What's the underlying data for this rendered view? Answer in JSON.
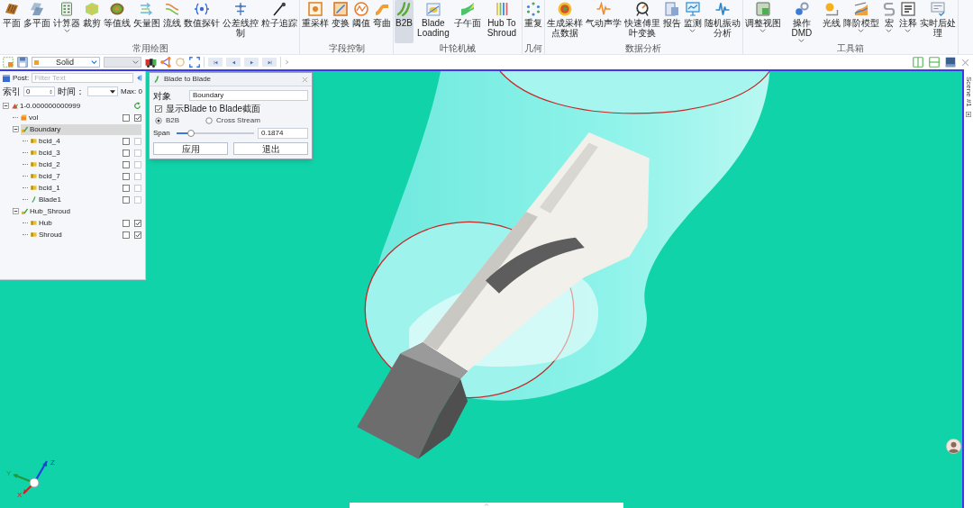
{
  "ribbon": {
    "groups": [
      {
        "title": "常用绘图",
        "buttons": [
          {
            "label": "平面",
            "dropdown": false,
            "selected": false
          },
          {
            "label": "多平面",
            "dropdown": false,
            "selected": false
          },
          {
            "label": "计算器",
            "dropdown": true,
            "selected": false
          },
          {
            "label": "裁剪",
            "dropdown": false,
            "selected": false
          },
          {
            "label": "等值线",
            "dropdown": false,
            "selected": false
          },
          {
            "label": "矢量图",
            "dropdown": false,
            "selected": false
          },
          {
            "label": "流线",
            "dropdown": false,
            "selected": false
          },
          {
            "label": "数值探针",
            "dropdown": false,
            "selected": false
          },
          {
            "label": "公差线控制",
            "dropdown": false,
            "selected": false
          },
          {
            "label": "粒子追踪",
            "dropdown": false,
            "selected": false
          }
        ]
      },
      {
        "title": "字段控制",
        "buttons": [
          {
            "label": "重采样",
            "dropdown": false,
            "selected": false
          },
          {
            "label": "变换",
            "dropdown": false,
            "selected": false
          },
          {
            "label": "阈值",
            "dropdown": false,
            "selected": false
          },
          {
            "label": "弯曲",
            "dropdown": false,
            "selected": false
          }
        ]
      },
      {
        "title": "叶轮机械",
        "buttons": [
          {
            "label": "B2B",
            "dropdown": false,
            "selected": true
          },
          {
            "label": "Blade Loading",
            "dropdown": false,
            "selected": false
          },
          {
            "label": "子午面",
            "dropdown": false,
            "selected": false
          },
          {
            "label": "Hub To Shroud",
            "dropdown": false,
            "selected": false
          }
        ]
      },
      {
        "title": "几何",
        "buttons": [
          {
            "label": "重复",
            "dropdown": false,
            "selected": false
          }
        ]
      },
      {
        "title": "数据分析",
        "buttons": [
          {
            "label": "生成采样点数据",
            "dropdown": false,
            "selected": false
          },
          {
            "label": "气动声学",
            "dropdown": false,
            "selected": false
          },
          {
            "label": "快速傅里叶变换",
            "dropdown": false,
            "selected": false
          },
          {
            "label": "报告",
            "dropdown": false,
            "selected": false
          },
          {
            "label": "监测",
            "dropdown": true,
            "selected": false
          },
          {
            "label": "随机振动分析",
            "dropdown": false,
            "selected": false
          }
        ]
      },
      {
        "title": "工具箱",
        "buttons": [
          {
            "label": "调整视图",
            "dropdown": true,
            "selected": false
          },
          {
            "label": "操作DMD",
            "dropdown": true,
            "selected": false
          },
          {
            "label": "光线",
            "dropdown": false,
            "selected": false
          },
          {
            "label": "降阶模型",
            "dropdown": true,
            "selected": false
          },
          {
            "label": "宏",
            "dropdown": true,
            "selected": false
          },
          {
            "label": "注释",
            "dropdown": true,
            "selected": false
          },
          {
            "label": "实时后处理",
            "dropdown": false,
            "selected": false
          }
        ]
      }
    ]
  },
  "view_toolbar": {
    "style_dropdown": "Solid"
  },
  "tree_panel": {
    "title": "Post:",
    "filter": {
      "placeholder": "Filter Text"
    },
    "index": {
      "label": "索引",
      "value": "0"
    },
    "time": {
      "label": "时间："
    },
    "max": "Max: 0",
    "nodes": [
      {
        "label": "1-0.000000000999",
        "kind": "root",
        "expanded": true,
        "selected": false,
        "children": [
          {
            "label": "vol",
            "kind": "volume",
            "selected": false,
            "checkbox_1": false,
            "checkbox_2": true
          },
          {
            "label": "Boundary",
            "kind": "group",
            "expanded": true,
            "selected": true,
            "children": [
              {
                "label": "bcid_4",
                "kind": "boundary",
                "selected": false,
                "checkbox_1": false,
                "checkbox_2": false
              },
              {
                "label": "bcid_3",
                "kind": "boundary",
                "selected": false,
                "checkbox_1": false,
                "checkbox_2": false
              },
              {
                "label": "bcid_2",
                "kind": "boundary",
                "selected": false,
                "checkbox_1": false,
                "checkbox_2": false
              },
              {
                "label": "bcid_7",
                "kind": "boundary",
                "selected": false,
                "checkbox_1": false,
                "checkbox_2": false
              },
              {
                "label": "bcid_1",
                "kind": "boundary",
                "selected": false,
                "checkbox_1": false,
                "checkbox_2": false
              },
              {
                "label": "Blade1",
                "kind": "blade",
                "selected": false,
                "checkbox_1": false,
                "checkbox_2": false
              }
            ]
          },
          {
            "label": "Hub_Shroud",
            "kind": "group",
            "expanded": true,
            "selected": false,
            "children": [
              {
                "label": "Hub",
                "kind": "boundary",
                "selected": false,
                "checkbox_1": false,
                "checkbox_2": true
              },
              {
                "label": "Shroud",
                "kind": "boundary",
                "selected": false,
                "checkbox_1": false,
                "checkbox_2": true
              }
            ]
          }
        ]
      }
    ]
  },
  "dialog": {
    "title": "Blade to Blade",
    "object_label": "对象",
    "object_value": "Boundary",
    "show_section": {
      "label": "显示Blade to Blade截面",
      "checked": true
    },
    "modes": [
      {
        "label": "B2B",
        "selected": true
      },
      {
        "label": "Cross Stream",
        "selected": false
      }
    ],
    "span": {
      "label": "Span",
      "level": 0.19,
      "value": "0.1874"
    },
    "buttons": [
      "应用",
      "退出"
    ]
  },
  "viewport": {
    "scene_tab": "Scene #1",
    "axes": [
      {
        "label": "X"
      },
      {
        "label": "Y"
      },
      {
        "label": "Z"
      }
    ]
  }
}
